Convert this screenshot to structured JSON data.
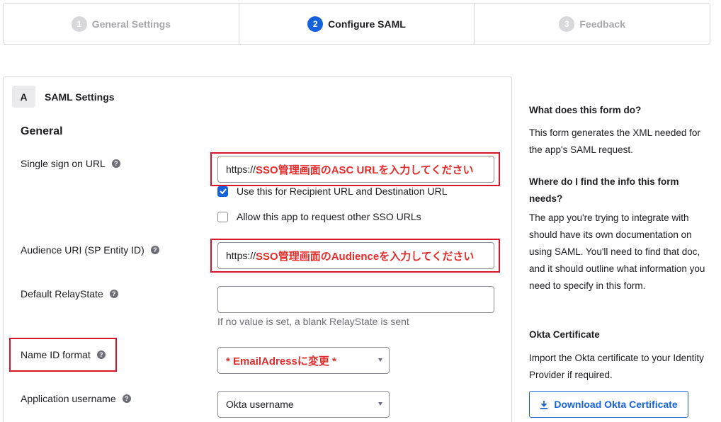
{
  "stepper": {
    "steps": [
      {
        "num": "1",
        "label": "General Settings"
      },
      {
        "num": "2",
        "label": "Configure SAML"
      },
      {
        "num": "3",
        "label": "Feedback"
      }
    ]
  },
  "panel": {
    "badge": "A",
    "title": "SAML Settings",
    "section": "General",
    "sso_url": {
      "label": "Single sign on URL",
      "prefix": "https://",
      "value_note": "SSO管理画面のASC URLを入力してください"
    },
    "recipient_checkbox": {
      "label": "Use this for Recipient URL and Destination URL",
      "checked": true
    },
    "other_sso_checkbox": {
      "label": "Allow this app to request other SSO URLs",
      "checked": false
    },
    "audience": {
      "label": "Audience URI (SP Entity ID)",
      "prefix": "https://",
      "value_note": "SSO管理画面のAudienceを入力してください"
    },
    "relay": {
      "label": "Default RelayState",
      "value": "",
      "hint": "If no value is set, a blank RelayState is sent"
    },
    "name_id": {
      "label": "Name ID format",
      "value": "* EmailAdressに変更 *"
    },
    "app_username": {
      "label": "Application username",
      "value": "Okta username"
    }
  },
  "sidebar": {
    "q1": "What does this form do?",
    "a1": "This form generates the XML needed for the app's SAML request.",
    "q2": "Where do I find the info this form needs?",
    "a2": "The app you're trying to integrate with should have its own documentation on using SAML. You'll need to find that doc, and it should outline what information you need to specify in this form.",
    "q3": "Okta Certificate",
    "a3": "Import the Okta certificate to your Identity Provider if required.",
    "download_label": "Download Okta Certificate"
  },
  "colors": {
    "primary": "#1662dd",
    "highlight": "#d9152c",
    "annotation": "#e12c2c"
  },
  "icons": [
    "help-icon",
    "check-icon",
    "download-icon",
    "caret-down-icon"
  ]
}
